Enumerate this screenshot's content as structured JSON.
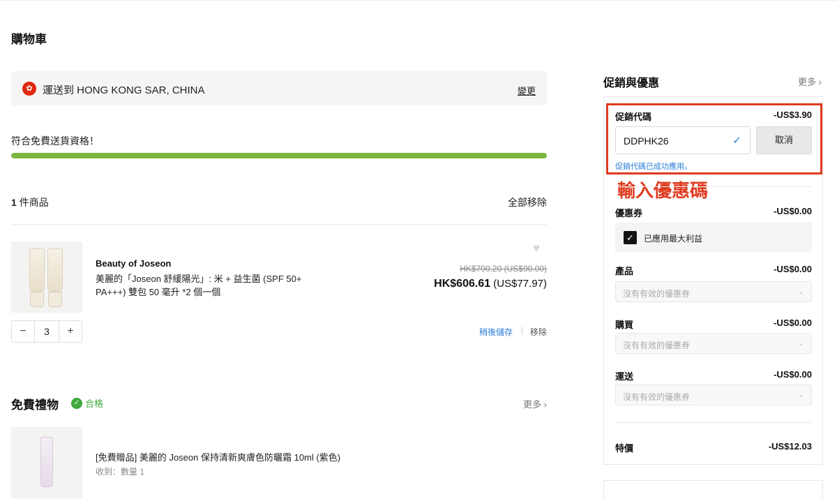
{
  "page_title": "購物車",
  "shipping": {
    "flag_icon": "hong-kong-flag-icon",
    "text": "運送到 HONG KONG SAR, CHINA",
    "change_label": "變更"
  },
  "free_shipping": {
    "text": "符合免費送貨資格！",
    "progress": 1.0
  },
  "items_header": {
    "count": "1",
    "count_label": " 件商品",
    "remove_all": "全部移除"
  },
  "cart_item": {
    "brand": "Beauty of Joseon",
    "name": "美麗的「Joseon 舒緩陽光」: 米 + 益生菌 (SPF 50+ PA+++) 雙包 50 毫升 *2 個一個",
    "old_price": "HK$700.20 (US$90.00)",
    "price": "HK$606.61",
    "price_usd": " (US$77.97)",
    "quantity": "3",
    "minus": "−",
    "plus": "+",
    "save_later": "稍後儲存",
    "separator": "|",
    "remove": "移除"
  },
  "gifts": {
    "title": "免費禮物",
    "qualify": "合格",
    "more": "更多 ›",
    "item_name": "[免費贈品] 美麗的 Joseon 保持清新爽膚色防曬霜 10ml (紫色)",
    "item_qty": "收到：數量 1"
  },
  "promo": {
    "title": "促銷與優惠",
    "more": "更多 ›",
    "code_label": "促銷代碼",
    "code_amount": "-US$3.90",
    "code_value": "DDPHK26",
    "cancel_label": "取消",
    "success_msg": "促銷代碼已成功應用。",
    "annotation": "輸入優惠碼",
    "coupon_label": "優惠券",
    "coupon_amount": "-US$0.00",
    "applied_label": "已應用最大利益",
    "product_label": "產品",
    "product_amount": "-US$0.00",
    "product_placeholder": "沒有有效的優惠券",
    "purchase_label": "購買",
    "purchase_amount": "-US$0.00",
    "purchase_placeholder": "沒有有效的優惠券",
    "shipping_label": "運送",
    "shipping_amount": "-US$0.00",
    "shipping_placeholder": "沒有有效的優惠券",
    "special_label": "特價",
    "special_amount": "-US$12.03"
  },
  "colors": {
    "accent_green": "#7cb73f",
    "annotation_red": "#e03a1e",
    "link_blue": "#2b7bd9"
  }
}
